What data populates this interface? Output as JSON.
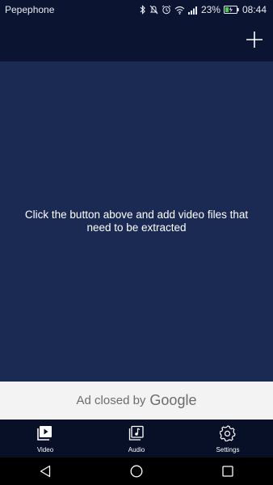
{
  "status_bar": {
    "carrier": "Pepephone",
    "battery_percent": "23%",
    "time": "08:44",
    "icons": [
      "bluetooth-icon",
      "mute-icon",
      "alarm-icon",
      "wifi-icon",
      "signal-icon",
      "battery-charging-icon"
    ]
  },
  "toolbar": {
    "add_icon": "plus-icon"
  },
  "main": {
    "empty_message": "Click the button above and add video files that need to be extracted"
  },
  "ad": {
    "text": "Ad closed by",
    "brand": "Google"
  },
  "tabs": [
    {
      "label": "Video",
      "icon": "video-icon"
    },
    {
      "label": "Audio",
      "icon": "audio-file-icon"
    },
    {
      "label": "Settings",
      "icon": "gear-icon"
    }
  ],
  "nav": {
    "icons": [
      "back-icon",
      "home-icon",
      "recents-icon"
    ]
  },
  "colors": {
    "header_bg": "#0b1430",
    "content_bg": "#1a2a52",
    "tab_bar_bg": "#081028",
    "battery_green": "#3fd43f"
  }
}
